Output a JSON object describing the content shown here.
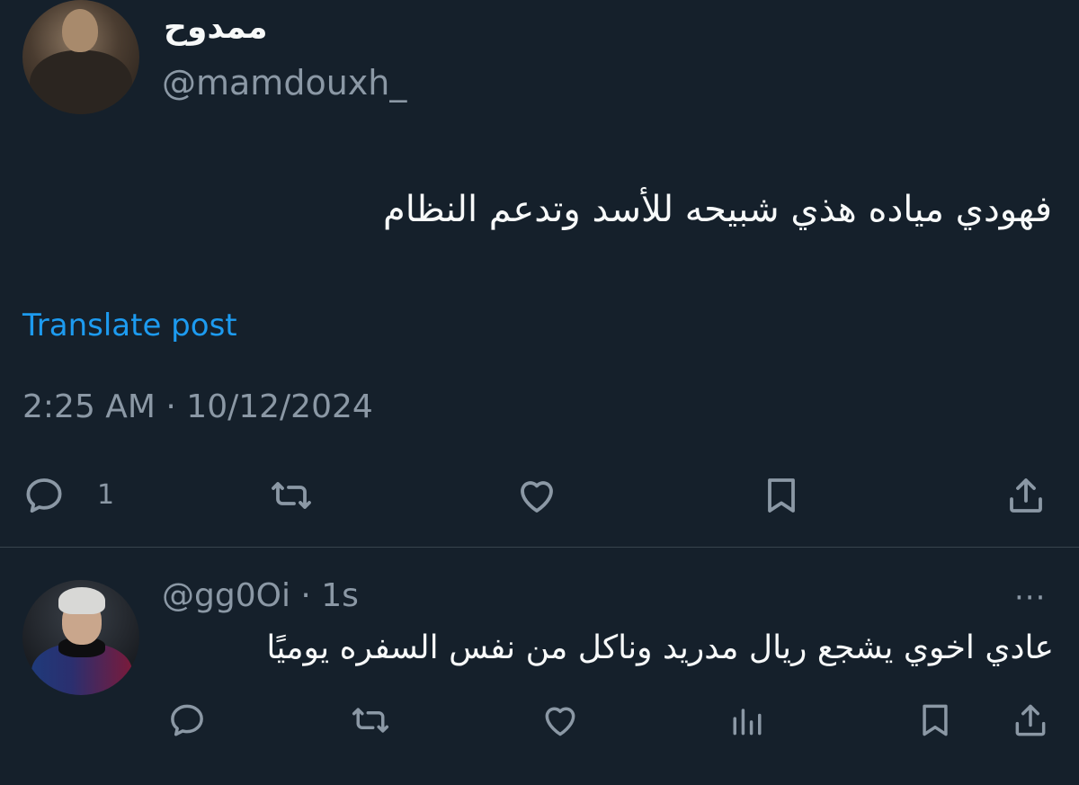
{
  "post": {
    "display_name": "ممدوح",
    "handle": "@mamdouxh_",
    "text": "فهودي مياده هذي شبيحه للأسد وتدعم النظام",
    "translate_label": "Translate post",
    "timestamp": "2:25 AM · 10/12/2024",
    "actions": {
      "reply_count": "1",
      "reply_icon": "reply-icon",
      "repost_icon": "repost-icon",
      "like_icon": "like-icon",
      "bookmark_icon": "bookmark-icon",
      "share_icon": "share-icon"
    }
  },
  "reply": {
    "handle_time": "@gg0Oi · 1s",
    "more_label": "···",
    "text": "عادي اخوي يشجع ريال مدريد وناكل من نفس السفره يوميًا",
    "actions": {
      "reply_icon": "reply-icon",
      "repost_icon": "repost-icon",
      "like_icon": "like-icon",
      "views_icon": "views-icon",
      "bookmark_icon": "bookmark-icon",
      "share_icon": "share-icon"
    }
  },
  "colors": {
    "background": "#15202b",
    "primary_text": "#f7f9f9",
    "secondary_text": "#8b98a5",
    "accent": "#1d9bf0",
    "divider": "#38444d"
  }
}
